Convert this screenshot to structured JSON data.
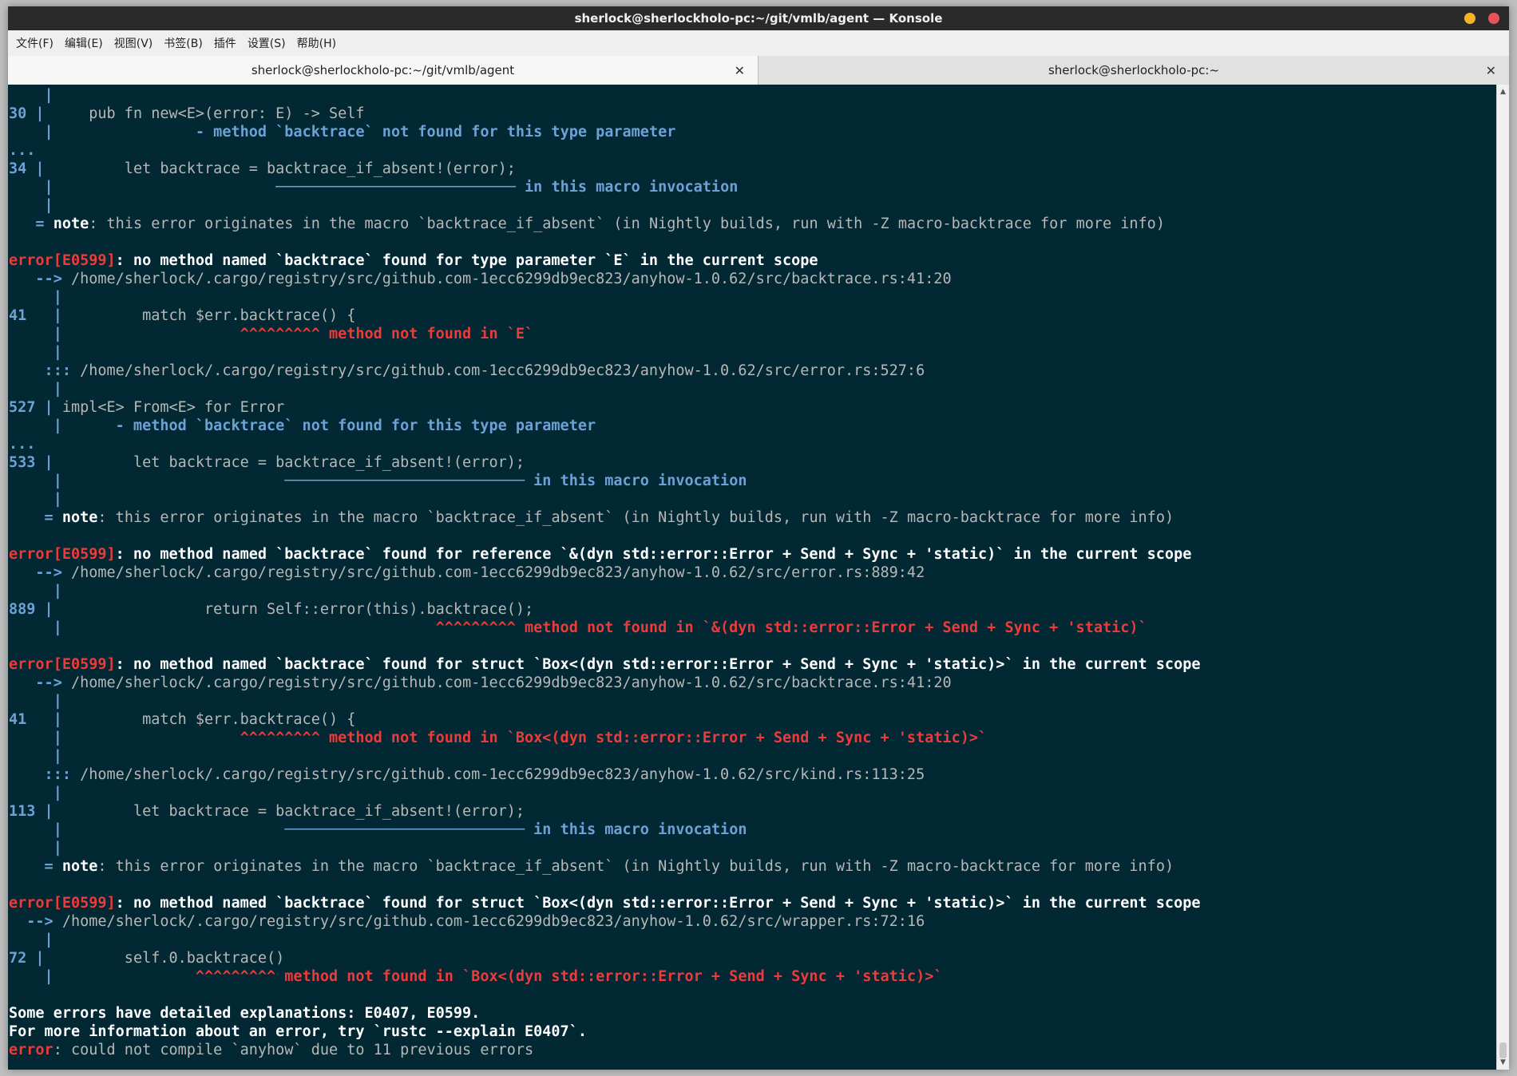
{
  "window": {
    "title": "sherlock@sherlockholo-pc:~/git/vmlb/agent — Konsole"
  },
  "menu": {
    "items": [
      "文件(F)",
      "编辑(E)",
      "视图(V)",
      "书签(B)",
      "插件",
      "设置(S)",
      "帮助(H)"
    ]
  },
  "tabs": [
    {
      "label": "sherlock@sherlockholo-pc:~/git/vmlb/agent",
      "close": "✕",
      "active": true
    },
    {
      "label": "sherlock@sherlockholo-pc:~",
      "close": "✕",
      "active": false
    }
  ],
  "colors": {
    "terminal_bg": "#022833",
    "gutter_blue": "#6ea1d6",
    "error_red": "#ec3b3b",
    "text_gray": "#b7b7b7"
  },
  "terminal": {
    "lines": [
      [
        [
          "gutter",
          "    |"
        ]
      ],
      [
        [
          "gutter",
          "30 |"
        ],
        [
          "g",
          "     pub fn new<E>(error: E) -> Self"
        ]
      ],
      [
        [
          "gutter",
          "    |"
        ],
        [
          "blue",
          "                - method `backtrace` not found for this type parameter"
        ]
      ],
      [
        [
          "gutter",
          "..."
        ]
      ],
      [
        [
          "gutter",
          "34 |"
        ],
        [
          "g",
          "         let backtrace = backtrace_if_absent!(error);"
        ]
      ],
      [
        [
          "gutter",
          "    |"
        ],
        [
          "u",
          "                         ───────────────────────────"
        ],
        [
          "blue",
          " in this macro invocation"
        ]
      ],
      [
        [
          "gutter",
          "    |"
        ]
      ],
      [
        [
          "gutter",
          "   ="
        ],
        [
          "white",
          " note"
        ],
        [
          "g",
          ": this error originates in the macro `backtrace_if_absent` (in Nightly builds, run with -Z macro-backtrace for more info)"
        ]
      ],
      [],
      [
        [
          "errb",
          "error[E0599]"
        ],
        [
          "white",
          ": no method named `backtrace` found for type parameter `E` in the current scope"
        ]
      ],
      [
        [
          "gutter",
          "   -->"
        ],
        [
          "g",
          " /home/sherlock/.cargo/registry/src/github.com-1ecc6299db9ec823/anyhow-1.0.62/src/backtrace.rs:41:20"
        ]
      ],
      [
        [
          "gutter",
          "     |"
        ]
      ],
      [
        [
          "gutter",
          "41   |"
        ],
        [
          "g",
          "         match $err.backtrace() {"
        ]
      ],
      [
        [
          "gutter",
          "     |"
        ],
        [
          "errb",
          "                    ^^^^^^^^^ method not found in `E`"
        ]
      ],
      [
        [
          "gutter",
          "     |"
        ]
      ],
      [
        [
          "gutter",
          "    :::"
        ],
        [
          "g",
          " /home/sherlock/.cargo/registry/src/github.com-1ecc6299db9ec823/anyhow-1.0.62/src/error.rs:527:6"
        ]
      ],
      [
        [
          "gutter",
          "     |"
        ]
      ],
      [
        [
          "gutter",
          "527 |"
        ],
        [
          "g",
          " impl<E> From<E> for Error"
        ]
      ],
      [
        [
          "gutter",
          "     |"
        ],
        [
          "blue",
          "      - method `backtrace` not found for this type parameter"
        ]
      ],
      [
        [
          "gutter",
          "..."
        ]
      ],
      [
        [
          "gutter",
          "533 |"
        ],
        [
          "g",
          "         let backtrace = backtrace_if_absent!(error);"
        ]
      ],
      [
        [
          "gutter",
          "     |"
        ],
        [
          "u",
          "                         ───────────────────────────"
        ],
        [
          "blue",
          " in this macro invocation"
        ]
      ],
      [
        [
          "gutter",
          "     |"
        ]
      ],
      [
        [
          "gutter",
          "    ="
        ],
        [
          "white",
          " note"
        ],
        [
          "g",
          ": this error originates in the macro `backtrace_if_absent` (in Nightly builds, run with -Z macro-backtrace for more info)"
        ]
      ],
      [],
      [
        [
          "errb",
          "error[E0599]"
        ],
        [
          "white",
          ": no method named `backtrace` found for reference `&(dyn std::error::Error + Send + Sync + 'static)` in the current scope"
        ]
      ],
      [
        [
          "gutter",
          "   -->"
        ],
        [
          "g",
          " /home/sherlock/.cargo/registry/src/github.com-1ecc6299db9ec823/anyhow-1.0.62/src/error.rs:889:42"
        ]
      ],
      [
        [
          "gutter",
          "     |"
        ]
      ],
      [
        [
          "gutter",
          "889 |"
        ],
        [
          "g",
          "                 return Self::error(this).backtrace();"
        ]
      ],
      [
        [
          "gutter",
          "     |"
        ],
        [
          "errb",
          "                                          ^^^^^^^^^ method not found in `&(dyn std::error::Error + Send + Sync + 'static)`"
        ]
      ],
      [],
      [
        [
          "errb",
          "error[E0599]"
        ],
        [
          "white",
          ": no method named `backtrace` found for struct `Box<(dyn std::error::Error + Send + Sync + 'static)>` in the current scope"
        ]
      ],
      [
        [
          "gutter",
          "   -->"
        ],
        [
          "g",
          " /home/sherlock/.cargo/registry/src/github.com-1ecc6299db9ec823/anyhow-1.0.62/src/backtrace.rs:41:20"
        ]
      ],
      [
        [
          "gutter",
          "     |"
        ]
      ],
      [
        [
          "gutter",
          "41   |"
        ],
        [
          "g",
          "         match $err.backtrace() {"
        ]
      ],
      [
        [
          "gutter",
          "     |"
        ],
        [
          "errb",
          "                    ^^^^^^^^^ method not found in `Box<(dyn std::error::Error + Send + Sync + 'static)>`"
        ]
      ],
      [
        [
          "gutter",
          "     |"
        ]
      ],
      [
        [
          "gutter",
          "    :::"
        ],
        [
          "g",
          " /home/sherlock/.cargo/registry/src/github.com-1ecc6299db9ec823/anyhow-1.0.62/src/kind.rs:113:25"
        ]
      ],
      [
        [
          "gutter",
          "     |"
        ]
      ],
      [
        [
          "gutter",
          "113 |"
        ],
        [
          "g",
          "         let backtrace = backtrace_if_absent!(error);"
        ]
      ],
      [
        [
          "gutter",
          "     |"
        ],
        [
          "u",
          "                         ───────────────────────────"
        ],
        [
          "blue",
          " in this macro invocation"
        ]
      ],
      [
        [
          "gutter",
          "     |"
        ]
      ],
      [
        [
          "gutter",
          "    ="
        ],
        [
          "white",
          " note"
        ],
        [
          "g",
          ": this error originates in the macro `backtrace_if_absent` (in Nightly builds, run with -Z macro-backtrace for more info)"
        ]
      ],
      [],
      [
        [
          "errb",
          "error[E0599]"
        ],
        [
          "white",
          ": no method named `backtrace` found for struct `Box<(dyn std::error::Error + Send + Sync + 'static)>` in the current scope"
        ]
      ],
      [
        [
          "gutter",
          "  -->"
        ],
        [
          "g",
          " /home/sherlock/.cargo/registry/src/github.com-1ecc6299db9ec823/anyhow-1.0.62/src/wrapper.rs:72:16"
        ]
      ],
      [
        [
          "gutter",
          "    |"
        ]
      ],
      [
        [
          "gutter",
          "72 |"
        ],
        [
          "g",
          "         self.0.backtrace()"
        ]
      ],
      [
        [
          "gutter",
          "    |"
        ],
        [
          "errb",
          "                ^^^^^^^^^ method not found in `Box<(dyn std::error::Error + Send + Sync + 'static)>`"
        ]
      ],
      [],
      [
        [
          "white",
          "Some errors have detailed explanations: E0407, E0599."
        ]
      ],
      [
        [
          "white",
          "For more information about an error, try `rustc --explain E0407`."
        ]
      ],
      [
        [
          "errb",
          "error"
        ],
        [
          "g",
          ": could not compile `anyhow` due to 11 previous errors"
        ]
      ]
    ]
  }
}
